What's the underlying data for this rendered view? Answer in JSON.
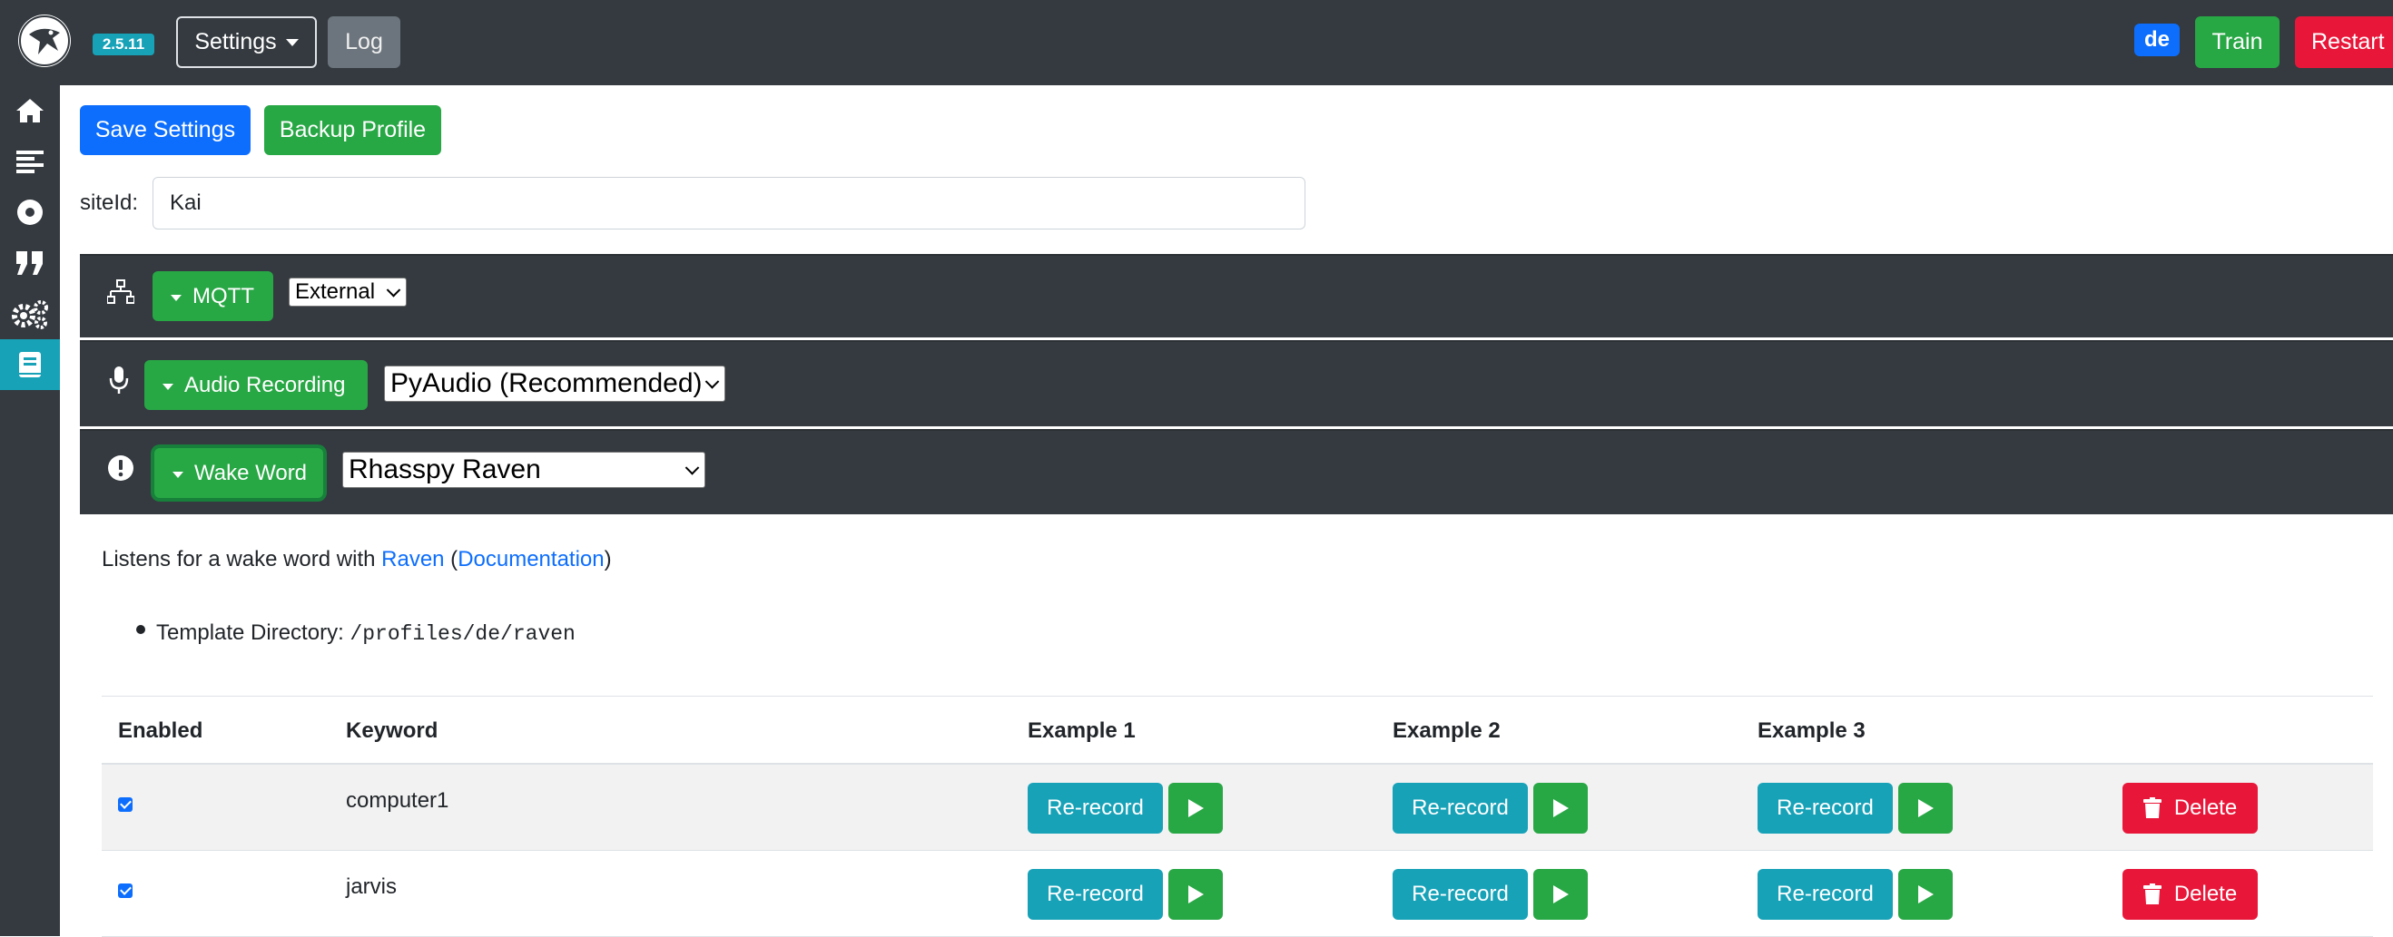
{
  "header": {
    "version": "2.5.11",
    "settings_label": "Settings",
    "log_label": "Log",
    "language": "de",
    "train_label": "Train",
    "restart_label": "Restart"
  },
  "sidebar": {
    "items": [
      {
        "icon": "home-icon"
      },
      {
        "icon": "align-left-icon"
      },
      {
        "icon": "record-icon"
      },
      {
        "icon": "quote-icon"
      },
      {
        "icon": "cogs-icon"
      },
      {
        "icon": "book-icon",
        "active": true
      }
    ]
  },
  "actions": {
    "save_label": "Save Settings",
    "backup_label": "Backup Profile"
  },
  "site": {
    "label": "siteId:",
    "value": "Kai"
  },
  "sections": {
    "mqtt": {
      "icon": "network-icon",
      "label": "MQTT",
      "selected": "External"
    },
    "audio": {
      "icon": "microphone-icon",
      "label": "Audio Recording",
      "selected": "PyAudio (Recommended)"
    },
    "wake": {
      "icon": "exclamation-circle-icon",
      "label": "Wake Word",
      "selected": "Rhasspy Raven"
    }
  },
  "wake_details": {
    "desc_prefix": "Listens for a wake word with ",
    "link_raven": "Raven",
    "paren_open": " (",
    "link_docs": "Documentation",
    "paren_close": ")",
    "template_label": "Template Directory: ",
    "template_path": "/profiles/de/raven"
  },
  "table": {
    "headers": [
      "Enabled",
      "Keyword",
      "Example 1",
      "Example 2",
      "Example 3"
    ],
    "rerecord_label": "Re-record",
    "delete_label": "Delete",
    "rows": [
      {
        "enabled": true,
        "keyword": "computer1"
      },
      {
        "enabled": true,
        "keyword": "jarvis"
      }
    ]
  },
  "colors": {
    "topbar": "#343a40",
    "primary": "#0d6efd",
    "success": "#28a745",
    "info": "#17a2b8",
    "danger": "#e8173a"
  }
}
